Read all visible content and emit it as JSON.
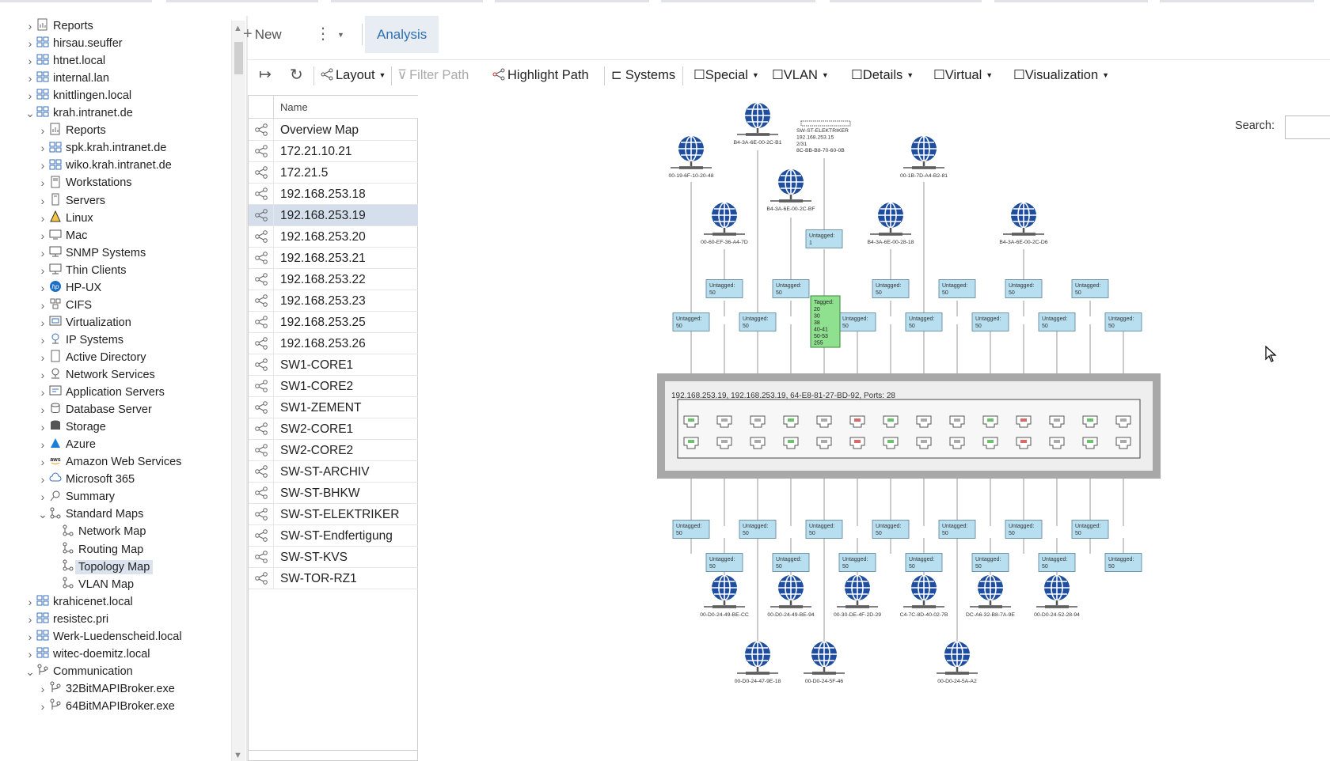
{
  "tree": {
    "items": [
      {
        "label": "Reports",
        "icon": "report-icon",
        "indent": 1,
        "expander": "collapsed"
      },
      {
        "label": "hirsau.seuffer",
        "icon": "domain-icon",
        "indent": 1,
        "expander": "collapsed"
      },
      {
        "label": "htnet.local",
        "icon": "domain-icon",
        "indent": 1,
        "expander": "collapsed"
      },
      {
        "label": "internal.lan",
        "icon": "domain-icon",
        "indent": 1,
        "expander": "collapsed"
      },
      {
        "label": "knittlingen.local",
        "icon": "domain-icon",
        "indent": 1,
        "expander": "collapsed"
      },
      {
        "label": "krah.intranet.de",
        "icon": "domain-icon",
        "indent": 1,
        "expander": "expanded"
      },
      {
        "label": "Reports",
        "icon": "report-icon",
        "indent": 2,
        "expander": "collapsed"
      },
      {
        "label": "spk.krah.intranet.de",
        "icon": "domain-icon",
        "indent": 2,
        "expander": "collapsed"
      },
      {
        "label": "wiko.krah.intranet.de",
        "icon": "domain-icon",
        "indent": 2,
        "expander": "collapsed"
      },
      {
        "label": "Workstations",
        "icon": "workstation-icon",
        "indent": 2,
        "expander": "collapsed"
      },
      {
        "label": "Servers",
        "icon": "server-icon",
        "indent": 2,
        "expander": "collapsed"
      },
      {
        "label": "Linux",
        "icon": "linux-icon",
        "indent": 2,
        "expander": "collapsed"
      },
      {
        "label": "Mac",
        "icon": "mac-icon",
        "indent": 2,
        "expander": "collapsed"
      },
      {
        "label": "SNMP Systems",
        "icon": "snmp-icon",
        "indent": 2,
        "expander": "collapsed"
      },
      {
        "label": "Thin Clients",
        "icon": "thin-client-icon",
        "indent": 2,
        "expander": "collapsed"
      },
      {
        "label": "HP-UX",
        "icon": "hp-icon",
        "indent": 2,
        "expander": "collapsed"
      },
      {
        "label": "CIFS",
        "icon": "cifs-icon",
        "indent": 2,
        "expander": "collapsed"
      },
      {
        "label": "Virtualization",
        "icon": "virtualization-icon",
        "indent": 2,
        "expander": "collapsed"
      },
      {
        "label": "IP Systems",
        "icon": "ip-systems-icon",
        "indent": 2,
        "expander": "collapsed"
      },
      {
        "label": "Active Directory",
        "icon": "active-directory-icon",
        "indent": 2,
        "expander": "collapsed"
      },
      {
        "label": "Network Services",
        "icon": "network-services-icon",
        "indent": 2,
        "expander": "collapsed"
      },
      {
        "label": "Application Servers",
        "icon": "application-server-icon",
        "indent": 2,
        "expander": "collapsed"
      },
      {
        "label": "Database Server",
        "icon": "database-icon",
        "indent": 2,
        "expander": "collapsed"
      },
      {
        "label": "Storage",
        "icon": "storage-icon",
        "indent": 2,
        "expander": "collapsed"
      },
      {
        "label": "Azure",
        "icon": "azure-icon",
        "indent": 2,
        "expander": "collapsed"
      },
      {
        "label": "Amazon Web Services",
        "icon": "aws-icon",
        "indent": 2,
        "expander": "collapsed"
      },
      {
        "label": "Microsoft 365",
        "icon": "cloud-icon",
        "indent": 2,
        "expander": "collapsed"
      },
      {
        "label": "Summary",
        "icon": "summary-icon",
        "indent": 2,
        "expander": "collapsed"
      },
      {
        "label": "Standard Maps",
        "icon": "map-icon",
        "indent": 2,
        "expander": "expanded"
      },
      {
        "label": "Network Map",
        "icon": "map-icon",
        "indent": 3,
        "expander": "none"
      },
      {
        "label": "Routing Map",
        "icon": "map-icon",
        "indent": 3,
        "expander": "none"
      },
      {
        "label": "Topology Map",
        "icon": "map-icon",
        "indent": 3,
        "expander": "none",
        "selected": true
      },
      {
        "label": "VLAN Map",
        "icon": "map-icon",
        "indent": 3,
        "expander": "none"
      },
      {
        "label": "krahicenet.local",
        "icon": "domain-icon",
        "indent": 1,
        "expander": "collapsed"
      },
      {
        "label": "resistec.pri",
        "icon": "domain-icon",
        "indent": 1,
        "expander": "collapsed"
      },
      {
        "label": "Werk-Luedenscheid.local",
        "icon": "domain-icon",
        "indent": 1,
        "expander": "collapsed"
      },
      {
        "label": "witec-doemitz.local",
        "icon": "domain-icon",
        "indent": 1,
        "expander": "collapsed"
      },
      {
        "label": "Communication",
        "icon": "communication-icon",
        "indent": 1,
        "expander": "expanded"
      },
      {
        "label": "32BitMAPIBroker.exe",
        "icon": "communication-icon",
        "indent": 2,
        "expander": "collapsed"
      },
      {
        "label": "64BitMAPIBroker.exe",
        "icon": "communication-icon",
        "indent": 2,
        "expander": "collapsed"
      }
    ]
  },
  "toolbar1": {
    "new_label": "New",
    "analysis_tab": "Analysis"
  },
  "toolbar2": {
    "layout": "Layout",
    "filter_path": "Filter Path",
    "highlight_path": "Highlight Path",
    "systems": "Systems",
    "special": "Special",
    "vlan": "VLAN",
    "details": "Details",
    "virtual": "Virtual",
    "visualization": "Visualization"
  },
  "list": {
    "header": "Name",
    "selected_index": 4,
    "rows": [
      "Overview Map",
      "172.21.10.21",
      "172.21.5",
      "192.168.253.18",
      "192.168.253.19",
      "192.168.253.20",
      "192.168.253.21",
      "192.168.253.22",
      "192.168.253.23",
      "192.168.253.25",
      "192.168.253.26",
      "SW1-CORE1",
      "SW1-CORE2",
      "SW1-ZEMENT",
      "SW2-CORE1",
      "SW2-CORE2",
      "SW-ST-ARCHIV",
      "SW-ST-BHKW",
      "SW-ST-ELEKTRIKER",
      "SW-ST-Endfertigung",
      "SW-ST-KVS",
      "SW-TOR-RZ1"
    ]
  },
  "search": {
    "label": "Search:"
  },
  "topology": {
    "switch_label": "192.168.253.19, 192.168.253.19, 64-E8-81-27-BD-92, Ports: 28",
    "vlan_untagged_label": "Untagged:",
    "vlan_untagged_value": "50",
    "vlan_untagged_1": "1",
    "vlan_tagged_label": "Tagged:",
    "vlan_tagged_values": "20\n30\n38\n40-41\n50-53\n255",
    "device_label_lines": [
      "SW-ST-ELEKTRIKER",
      "192.168.253.15",
      "2/31",
      "8C-BB-B8-70-60-0B"
    ],
    "hosts_top": [
      "00-19-6F-10-20-48",
      "B4-3A-6E-00-2C-B1",
      "00-60-EF-36-A4-7D",
      "B4-3A-6E-00-2C-BF",
      "00-1B-7D-A4-B2-81",
      "B4-3A-6E-00-28-18",
      "B4-3A-6E-00-2C-D6"
    ],
    "hosts_bottom": [
      "00-D0-24-49-BE-CC",
      "00-D0-24-49-BE-94",
      "00-30-DE-4F-2D-29",
      "C4-7C-8D-40-02-7B",
      "DC-A6-32-B8-7A-9E",
      "00-D0-24-52-28-94",
      "00-D0-24-47-9E-18",
      "00-D0-24-5F-46",
      "00-D0-24-5A-A2"
    ]
  },
  "colors": {
    "accent": "#2e6fb1",
    "selection": "#d5dfec",
    "vlan_box": "#b7dff0",
    "tagged_box": "#8fe08f",
    "globe": "#1f4e9e",
    "switch_frame": "#a8a8a8"
  }
}
